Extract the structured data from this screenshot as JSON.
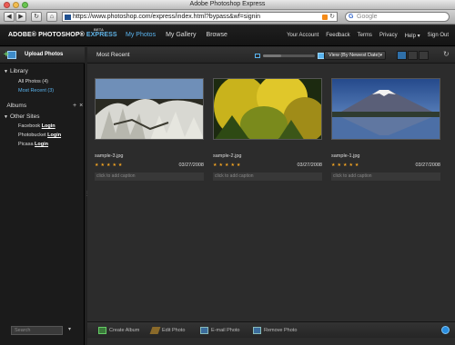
{
  "window": {
    "title": "Adobe Photoshop Express"
  },
  "browser": {
    "url": "https://www.photoshop.com/express/index.html?bypass&wf=signin",
    "search_placeholder": "Google"
  },
  "app": {
    "brand": "ADOBE® PHOTOSHOP®",
    "brand_suffix": "EXPRESS",
    "beta": "BETA",
    "main_nav": [
      "My Photos",
      "My Gallery",
      "Browse"
    ],
    "user_nav": [
      "Your Account",
      "Feedback",
      "Terms",
      "Privacy",
      "Help ▾",
      "Sign Out"
    ]
  },
  "sidebar": {
    "upload_label": "Upload Photos",
    "library_label": "Library",
    "library_items": [
      "All Photos (4)",
      "Most Recent (3)"
    ],
    "albums_label": "Albums",
    "other_sites_label": "Other Sites",
    "other_sites": [
      {
        "name": "Facebook",
        "link": "Login"
      },
      {
        "name": "Photobucket",
        "link": "Login"
      },
      {
        "name": "Picasa",
        "link": "Login"
      }
    ],
    "search_placeholder": "Search"
  },
  "content": {
    "title": "Most Recent",
    "view_select": "View (By Newest Date)",
    "photos": [
      {
        "file": "sample-3.jpg",
        "date": "03/27/2008",
        "stars": "★★★★★",
        "caption_placeholder": "click to add caption"
      },
      {
        "file": "sample-2.jpg",
        "date": "03/27/2008",
        "stars": "★★★★★",
        "caption_placeholder": "click to add caption"
      },
      {
        "file": "sample-1.jpg",
        "date": "03/27/2008",
        "stars": "★★★★★",
        "caption_placeholder": "click to add caption"
      }
    ],
    "actions": [
      "Create Album",
      "Edit Photo",
      "E-mail Photo",
      "Remove Photo"
    ]
  },
  "colors": {
    "accent": "#5ab4ef",
    "star": "#f3a422",
    "background": "#2b2b2b"
  },
  "icons": [
    "back-icon",
    "forward-icon",
    "reload-icon",
    "home-icon",
    "rss-icon",
    "upload-icon",
    "refresh-icon",
    "help-icon"
  ]
}
